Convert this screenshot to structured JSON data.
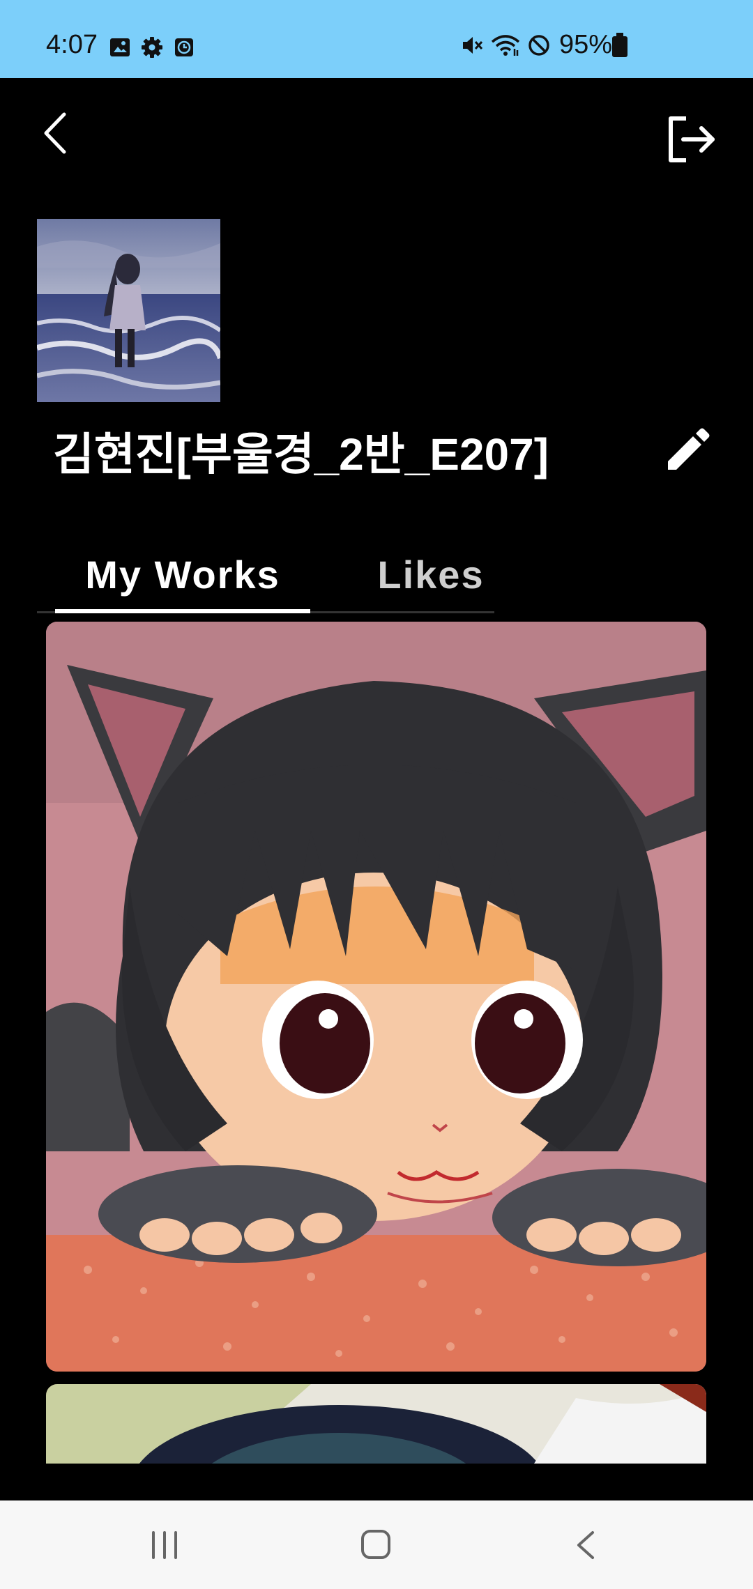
{
  "status_bar": {
    "time": "4:07",
    "battery_text": "95%",
    "icons": [
      "gallery-icon",
      "settings-gear-icon",
      "clock-app-icon",
      "mute-icon",
      "wifi-icon",
      "do-not-disturb-icon",
      "battery-icon"
    ],
    "background": "#7ccffa"
  },
  "top_nav": {
    "back_icon": "chevron-left-icon",
    "logout_icon": "logout-icon"
  },
  "profile": {
    "username": "김현진[부울경_2반_E207]",
    "edit_icon": "pencil-icon"
  },
  "tabs": [
    {
      "label": "My Works",
      "selected": true
    },
    {
      "label": "Likes",
      "selected": false
    }
  ],
  "works": [
    {
      "subject": "anime cat girl illustration"
    },
    {
      "subject": "partially visible artwork"
    }
  ],
  "nav_bar": {
    "icons": [
      "recent-apps-icon",
      "home-icon",
      "back-icon"
    ]
  }
}
